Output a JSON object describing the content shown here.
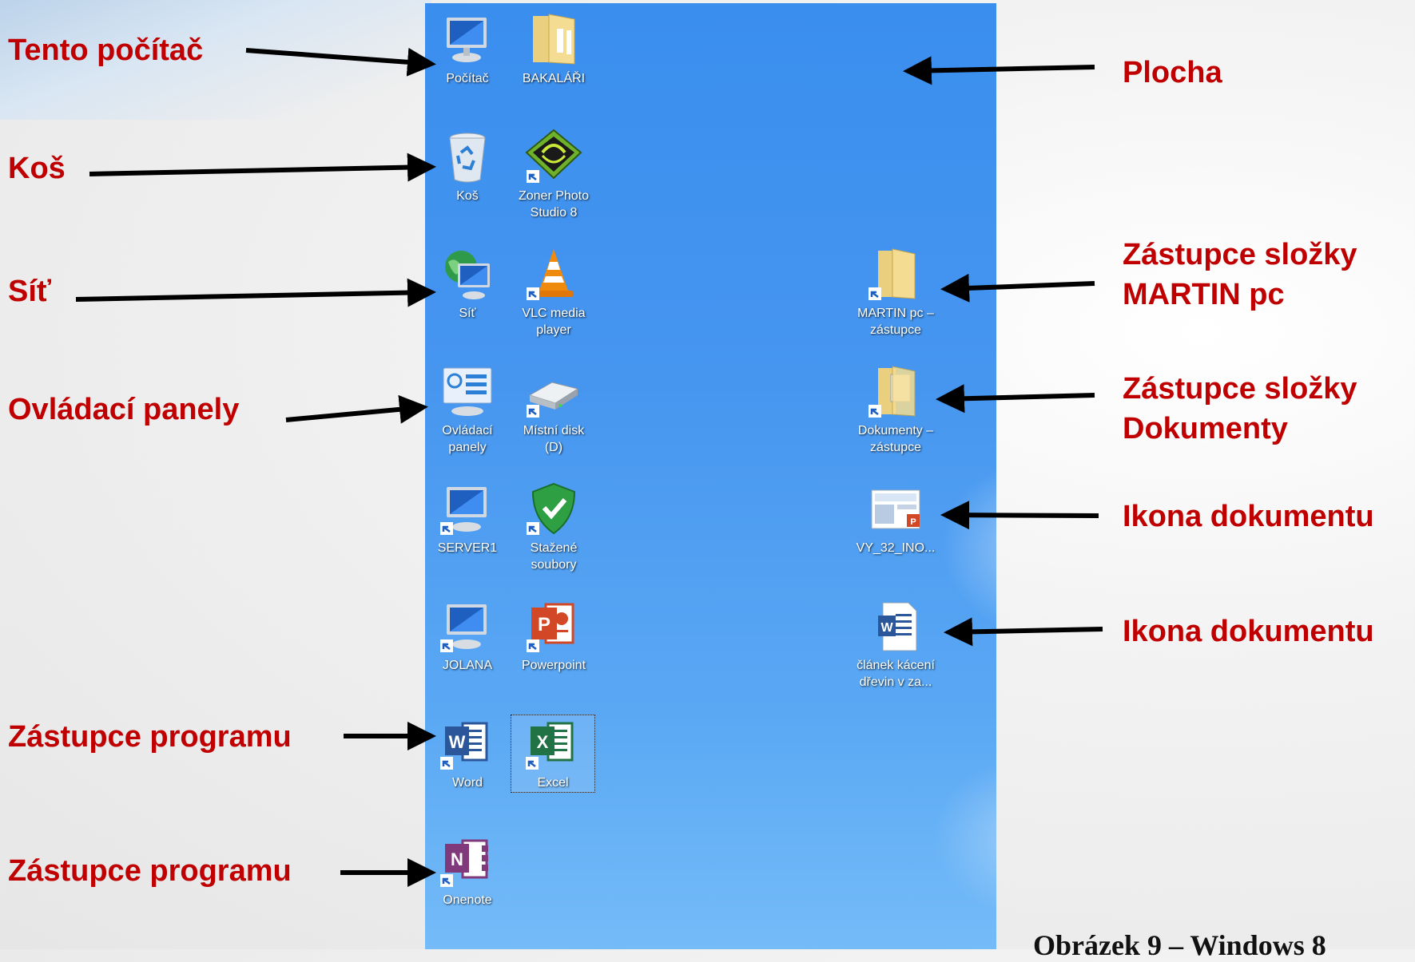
{
  "labels": {
    "tento_pocitac": "Tento počítač",
    "kos": "Koš",
    "sit": "Síť",
    "ovladaci_panely": "Ovládací panely",
    "zastupce_programu_1": "Zástupce programu",
    "zastupce_programu_2": "Zástupce programu",
    "plocha": "Plocha",
    "zastupce_slozky_martin_line1": "Zástupce složky",
    "zastupce_slozky_martin_line2": "MARTIN pc",
    "zastupce_slozky_dokumenty_line1": "Zástupce složky",
    "zastupce_slozky_dokumenty_line2": "Dokumenty",
    "ikona_dokumentu_1": "Ikona dokumentu",
    "ikona_dokumentu_2": "Ikona dokumentu"
  },
  "desktop_icons": {
    "pocitac": "Počítač",
    "bakalari": "BAKALÁŘI",
    "kos": "Koš",
    "zoner_line1": "Zoner Photo",
    "zoner_line2": "Studio 8",
    "sit": "Síť",
    "vlc_line1": "VLC media",
    "vlc_line2": "player",
    "ovladaci_line1": "Ovládací",
    "ovladaci_line2": "panely",
    "mistni_line1": "Místní disk",
    "mistni_line2": "(D)",
    "server1": "SERVER1",
    "stazene_line1": "Stažené",
    "stazene_line2": "soubory",
    "jolana": "JOLANA",
    "powerpoint": "Powerpoint",
    "word": "Word",
    "excel": "Excel",
    "onenote": "Onenote",
    "martin_line1": "MARTIN pc –",
    "martin_line2": "zástupce",
    "dokumenty_line1": "Dokumenty –",
    "dokumenty_line2": "zástupce",
    "vy32": "VY_32_INO...",
    "clanek_line1": "článek kácení",
    "clanek_line2": "dřevin v za..."
  },
  "caption": "Obrázek 9 – Windows 8",
  "colors": {
    "label": "#c00000",
    "desktop": "#4696f0",
    "arrow": "#000000"
  }
}
